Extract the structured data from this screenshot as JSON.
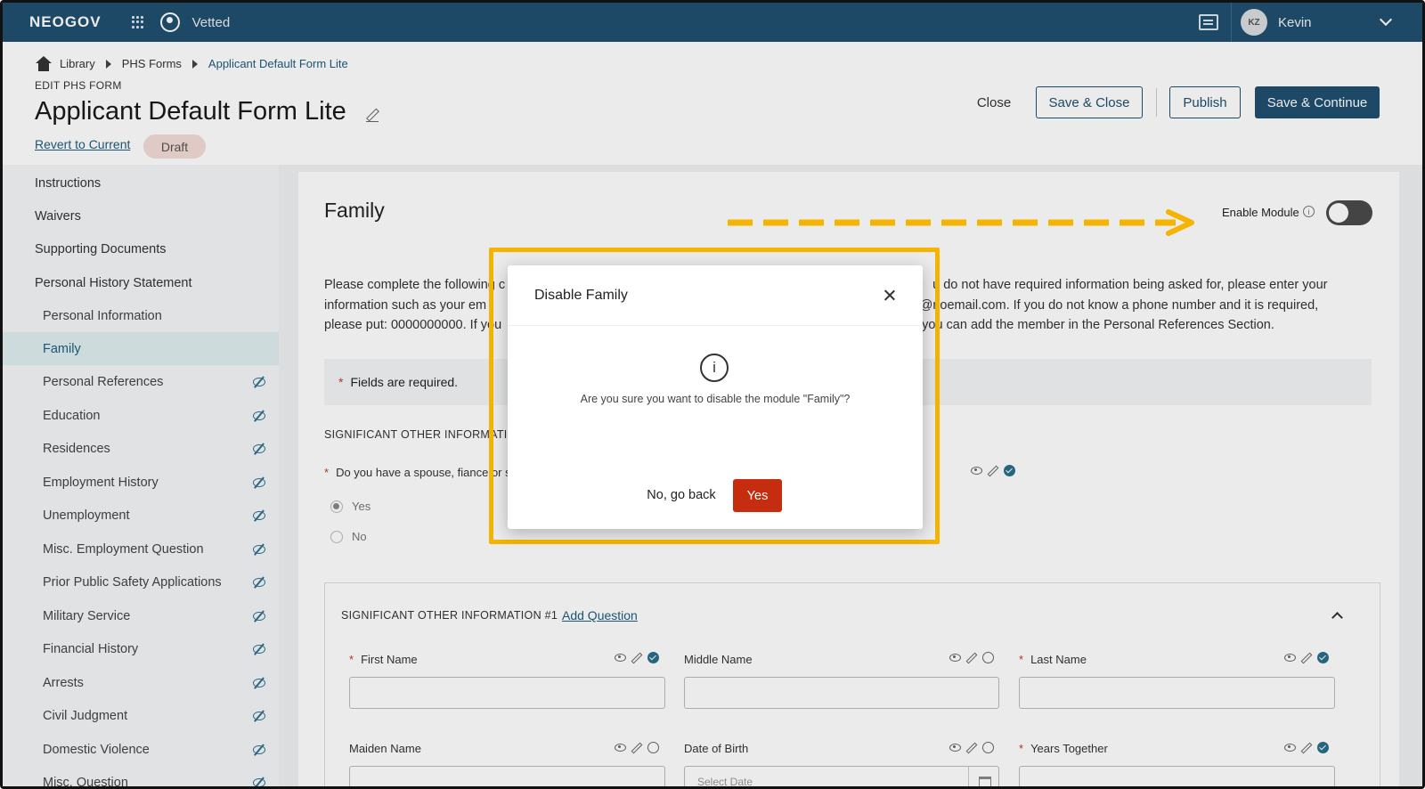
{
  "topbar": {
    "logo": "NEOGOV",
    "product": "Vetted",
    "user_initials": "KZ",
    "user_name": "Kevin"
  },
  "breadcrumb": [
    "Library",
    "PHS Forms",
    "Applicant Default Form Lite"
  ],
  "header": {
    "edit_label": "EDIT PHS FORM",
    "title": "Applicant Default Form Lite",
    "revert_link": "Revert to Current",
    "status_badge": "Draft"
  },
  "actions": {
    "close": "Close",
    "save_close": "Save & Close",
    "publish": "Publish",
    "save_continue": "Save & Continue"
  },
  "sidebar": {
    "top_items": [
      "Instructions",
      "Waivers",
      "Supporting Documents",
      "Personal History Statement"
    ],
    "sub_items": [
      {
        "label": "Personal Information",
        "hidden": false
      },
      {
        "label": "Family",
        "hidden": false,
        "active": true
      },
      {
        "label": "Personal References",
        "hidden": true
      },
      {
        "label": "Education",
        "hidden": true
      },
      {
        "label": "Residences",
        "hidden": true
      },
      {
        "label": "Employment History",
        "hidden": true
      },
      {
        "label": "Unemployment",
        "hidden": true
      },
      {
        "label": "Misc. Employment Question",
        "hidden": true
      },
      {
        "label": "Prior Public Safety Applications",
        "hidden": true
      },
      {
        "label": "Military Service",
        "hidden": true
      },
      {
        "label": "Financial History",
        "hidden": true
      },
      {
        "label": "Arrests",
        "hidden": true
      },
      {
        "label": "Civil Judgment",
        "hidden": true
      },
      {
        "label": "Domestic Violence",
        "hidden": true
      },
      {
        "label": "Misc. Question",
        "hidden": true
      }
    ]
  },
  "main": {
    "section_title": "Family",
    "enable_module_label": "Enable Module",
    "enable_module_on": false,
    "instructions_line1_a": "Please complete the following c",
    "instructions_line1_b": "u do not have required information being asked for, please enter your",
    "instructions_line2_a": "information such as your em",
    "instructions_line2_b": "ail@noemail.com. If you do not know a phone number and it is required,",
    "instructions_line3_a": "please put: 0000000000. If you",
    "instructions_line3_b": "you can add the member in the Personal References Section.",
    "required_note": "Fields are required.",
    "sig_heading": "SIGNIFICANT OTHER INFORMATIO",
    "question": "Do you have a spouse, fiance or s",
    "radio_yes": "Yes",
    "radio_no": "No",
    "subsection_title": "SIGNIFICANT OTHER INFORMATION #1",
    "add_question": "Add Question",
    "fields": {
      "first_name": "First Name",
      "middle_name": "Middle Name",
      "last_name": "Last Name",
      "maiden_name": "Maiden Name",
      "date_of_birth": "Date of Birth",
      "date_placeholder": "Select Date",
      "years_together": "Years Together"
    }
  },
  "modal": {
    "title": "Disable Family",
    "message": "Are you sure you want to disable the module \"Family\"?",
    "no_label": "No, go back",
    "yes_label": "Yes",
    "info_glyph": "i"
  },
  "colors": {
    "brand": "#20506f",
    "danger": "#c62d0f",
    "highlight": "#f4b400"
  }
}
